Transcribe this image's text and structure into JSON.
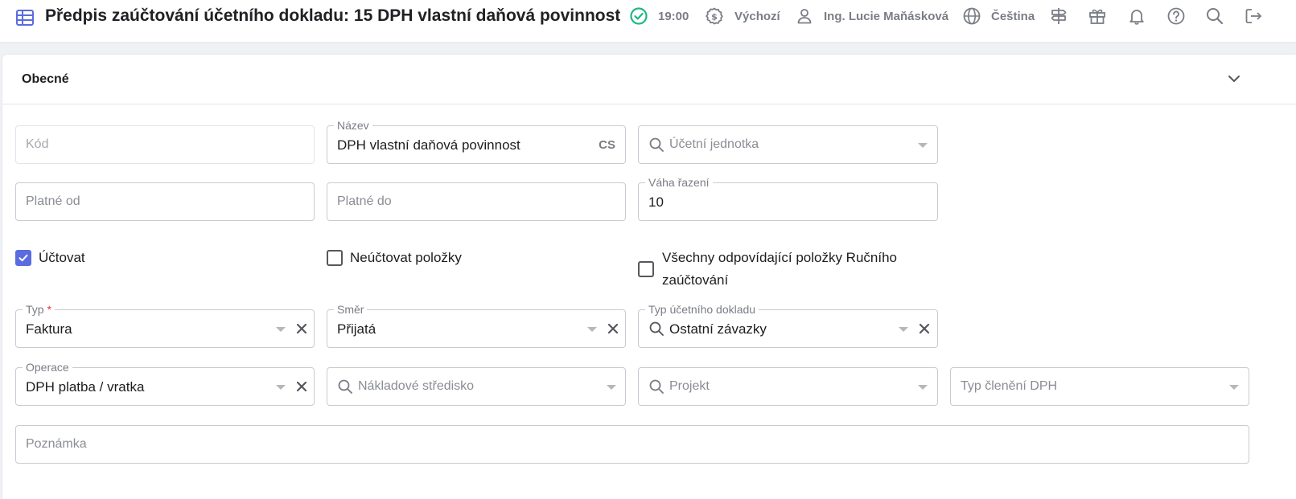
{
  "header": {
    "title": "Předpis zaúčtování účetního dokladu: 15 DPH vlastní daňová povinnost",
    "time": "19:00",
    "currency_profile": "Výchozí",
    "user": "Ing. Lucie Maňásková",
    "language": "Čeština",
    "icons": [
      "table-icon",
      "check-circle-icon",
      "currency-settings-icon",
      "user-icon",
      "globe-icon",
      "signpost-icon",
      "gift-icon",
      "bell-icon",
      "help-icon",
      "search-icon",
      "logout-icon"
    ]
  },
  "section": {
    "title": "Obecné"
  },
  "form": {
    "kod": {
      "placeholder": "Kód",
      "value": ""
    },
    "nazev": {
      "label": "Název",
      "value": "DPH vlastní daňová povinnost",
      "lang": "CS"
    },
    "ucetni_jednotka": {
      "placeholder": "Účetní jednotka"
    },
    "platne_od": {
      "placeholder": "Platné od"
    },
    "platne_do": {
      "placeholder": "Platné do"
    },
    "vaha_razeni": {
      "label": "Váha řazení",
      "value": "10"
    },
    "uctovat": {
      "label": "Účtovat",
      "checked": true
    },
    "neuctovat_polozky": {
      "label": "Neúčtovat položky",
      "checked": false
    },
    "vsechny_polozky": {
      "label_line1": "Všechny odpovídající položky Ručního",
      "label_line2": "zaúčtování",
      "checked": false
    },
    "typ": {
      "label": "Typ",
      "required_mark": "*",
      "value": "Faktura"
    },
    "smer": {
      "label": "Směr",
      "value": "Přijatá"
    },
    "typ_dokladu": {
      "label": "Typ účetního dokladu",
      "value": "Ostatní závazky"
    },
    "operace": {
      "label": "Operace",
      "value": "DPH platba / vratka"
    },
    "nakladove_stredisko": {
      "placeholder": "Nákladové středisko"
    },
    "projekt": {
      "placeholder": "Projekt"
    },
    "typ_cleneni_dph": {
      "placeholder": "Typ členění DPH"
    },
    "poznamka": {
      "placeholder": "Poznámka"
    }
  },
  "colors": {
    "accent": "#5b6be0",
    "status_ok": "#1fb880",
    "icon_gray": "#7a7d85"
  }
}
